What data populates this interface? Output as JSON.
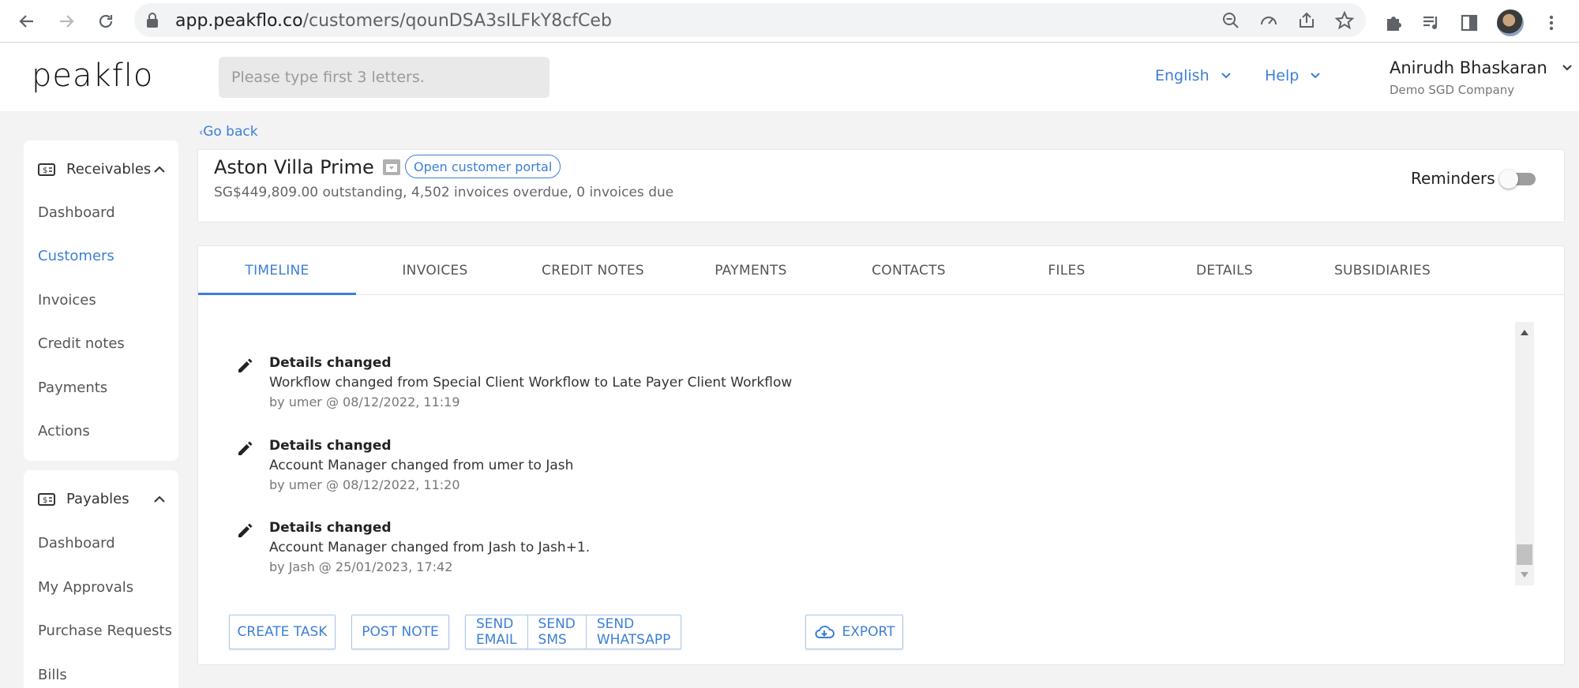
{
  "browser": {
    "url_host": "app.peakflo.co",
    "url_path": "/customers/qounDSA3sILFkY8cfCeb"
  },
  "header": {
    "logo": "peakflo",
    "search_placeholder": "Please type first 3 letters.",
    "language": "English",
    "help": "Help",
    "user_name": "Anirudh Bhaskaran",
    "company": "Demo SGD Company"
  },
  "sidebar": {
    "receivables": {
      "label": "Receivables",
      "items": [
        "Dashboard",
        "Customers",
        "Invoices",
        "Credit notes",
        "Payments",
        "Actions"
      ],
      "active": "Customers"
    },
    "payables": {
      "label": "Payables",
      "items": [
        "Dashboard",
        "My Approvals",
        "Purchase Requests",
        "Bills"
      ]
    }
  },
  "customer": {
    "go_back": "Go back",
    "name": "Aston Villa Prime",
    "portal_button": "Open customer portal",
    "summary": "SG$449,809.00 outstanding, 4,502 invoices overdue, 0 invoices due",
    "reminders_label": "Reminders",
    "reminders_on": false
  },
  "tabs": [
    "TIMELINE",
    "INVOICES",
    "CREDIT NOTES",
    "PAYMENTS",
    "CONTACTS",
    "FILES",
    "DETAILS",
    "SUBSIDIARIES"
  ],
  "active_tab": "TIMELINE",
  "timeline": [
    {
      "title": "Details changed",
      "description": "Workflow changed from Special Client Workflow to Late Payer Client Workflow",
      "meta": "by umer @ 08/12/2022, 11:19"
    },
    {
      "title": "Details changed",
      "description": "Account Manager changed from umer to Jash",
      "meta": "by umer @ 08/12/2022, 11:20"
    },
    {
      "title": "Details changed",
      "description": "Account Manager changed from Jash to Jash+1.",
      "meta": "by Jash @ 25/01/2023, 17:42"
    }
  ],
  "actions": {
    "create_task": "CREATE TASK",
    "post_note": "POST NOTE",
    "send_email": "SEND EMAIL",
    "send_sms": "SEND SMS",
    "send_whatsapp": "SEND WHATSAPP",
    "export": "EXPORT"
  },
  "colors": {
    "accent": "#3c7fd5",
    "background": "#f3f3f4"
  }
}
